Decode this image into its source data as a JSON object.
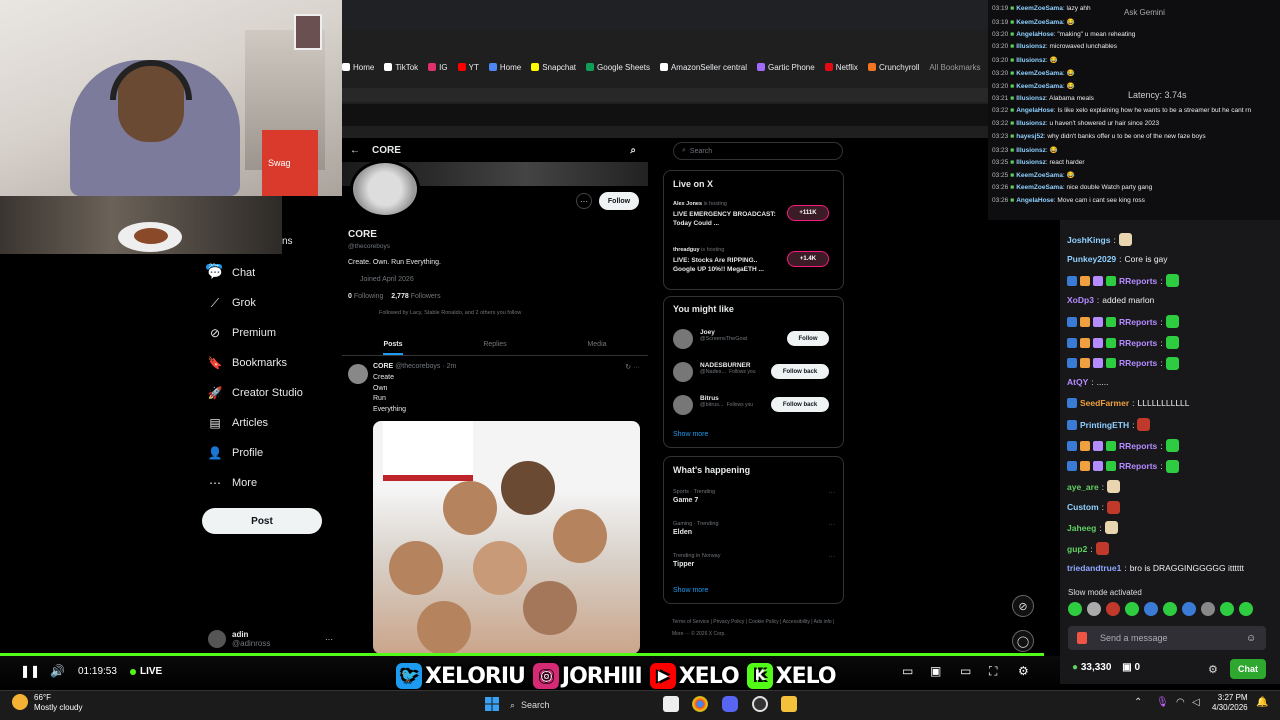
{
  "webcam": {
    "box_label": "Swag"
  },
  "nav": {
    "partial_label": "ns",
    "badge": "20+",
    "items": [
      {
        "label": "Chat",
        "icon": "chat-icon",
        "glyph": "💬"
      },
      {
        "label": "Grok",
        "icon": "grok-icon",
        "glyph": "⟋"
      },
      {
        "label": "Premium",
        "icon": "premium-icon",
        "glyph": "⊘"
      },
      {
        "label": "Bookmarks",
        "icon": "bookmark-icon",
        "glyph": "🔖"
      },
      {
        "label": "Creator Studio",
        "icon": "rocket-icon",
        "glyph": "🚀"
      },
      {
        "label": "Articles",
        "icon": "articles-icon",
        "glyph": "▤"
      },
      {
        "label": "Profile",
        "icon": "profile-icon",
        "glyph": "👤"
      },
      {
        "label": "More",
        "icon": "more-icon",
        "glyph": "⋯"
      }
    ],
    "post_label": "Post",
    "user": {
      "name": "adin",
      "handle": "@adinross"
    }
  },
  "browser": {
    "ask_gemini": "Ask Gemini",
    "bookmarks": [
      {
        "label": "Home",
        "color": "#ffffff"
      },
      {
        "label": "TikTok",
        "color": "#ffffff"
      },
      {
        "label": "IG",
        "color": "#e1306c"
      },
      {
        "label": "YT",
        "color": "#ff0000"
      },
      {
        "label": "Home",
        "color": "#4f86f7"
      },
      {
        "label": "Snapchat",
        "color": "#fffc00"
      },
      {
        "label": "Google Sheets",
        "color": "#0f9d58"
      },
      {
        "label": "AmazonSeller central",
        "color": "#ffffff"
      },
      {
        "label": "Gartic Phone",
        "color": "#a06bff"
      },
      {
        "label": "Netflix",
        "color": "#e50914"
      },
      {
        "label": "Crunchyroll",
        "color": "#f47521"
      }
    ],
    "all_bookmarks": "All Bookmarks"
  },
  "profile": {
    "header_name": "CORE",
    "name": "CORE",
    "handle": "@thecoreboys",
    "bio": "Create. Own. Run Everything.",
    "joined": "Joined April 2026",
    "following_count": "0",
    "following_label": "Following",
    "followers_count": "2,778",
    "followers_label": "Followers",
    "followed_by": "Followed by Lacy, Stable Ronaldo, and 2 others you follow",
    "follow_label": "Follow",
    "tabs": [
      "Posts",
      "Replies",
      "Media"
    ]
  },
  "tweet": {
    "name": "CORE",
    "handle_time": "@thecoreboys · 2m",
    "lines": [
      "Create",
      "Own",
      "Run",
      "Everything"
    ]
  },
  "sidebar": {
    "search_placeholder": "Search",
    "live_title": "Live on X",
    "live": [
      {
        "host": "Alex Jones",
        "hosting": "is hosting",
        "title": "LIVE EMERGENCY BROADCAST: Today Could ...",
        "count": "+111K"
      },
      {
        "host": "threadguy",
        "hosting": "is hosting",
        "title": "LIVE: Stocks Are RIPPING.. Google UP 10%!! MegaETH ...",
        "count": "+1.4K"
      }
    ],
    "might_like_title": "You might like",
    "might_like": [
      {
        "name": "Joey",
        "handle": "@ScreensTheGoat",
        "action": "Follow",
        "follows_you": ""
      },
      {
        "name": "NADESBURNER",
        "handle": "@Nades...",
        "action": "Follow back",
        "follows_you": "Follows you"
      },
      {
        "name": "Bitrus",
        "handle": "@bitrus...",
        "action": "Follow back",
        "follows_you": "Follows you"
      }
    ],
    "show_more": "Show more",
    "happening_title": "What's happening",
    "happening": [
      {
        "context": "Sports · Trending",
        "topic": "Game 7"
      },
      {
        "context": "Gaming · Trending",
        "topic": "Elden"
      },
      {
        "context": "Trending in Norway",
        "topic": "Tipper"
      }
    ],
    "footer": "Terms of Service | Privacy Policy | Cookie Policy | Accessibility | Ads info | More ··· © 2026 X Corp."
  },
  "overlay_chat": {
    "latency": "Latency: 3.74s",
    "lines": [
      {
        "time": "03:19",
        "user": "KeemZoeSama",
        "msg": "lazy ahh"
      },
      {
        "time": "03:19",
        "user": "KeemZoeSama",
        "msg": "😂"
      },
      {
        "time": "03:20",
        "user": "AngelaHose",
        "msg": "\"making\" u mean reheating"
      },
      {
        "time": "03:20",
        "user": "Illusionsz",
        "msg": "microwaved lunchables"
      },
      {
        "time": "03:20",
        "user": "Illusionsz",
        "msg": "😂"
      },
      {
        "time": "03:20",
        "user": "KeemZoeSama",
        "msg": "😂"
      },
      {
        "time": "03:20",
        "user": "KeemZoeSama",
        "msg": "😂"
      },
      {
        "time": "03:21",
        "user": "Illusionsz",
        "msg": "Alabama meals"
      },
      {
        "time": "03:22",
        "user": "AngelaHose",
        "msg": "Is like xelo explaining how he wants to be a streamer but he cant rn"
      },
      {
        "time": "03:22",
        "user": "Illusionsz",
        "msg": "u haven't showered ur hair since 2023"
      },
      {
        "time": "03:23",
        "user": "hayesj52",
        "msg": "why didn't banks offer u to be one of the new faze boys"
      },
      {
        "time": "03:23",
        "user": "Illusionsz",
        "msg": "😂"
      },
      {
        "time": "03:25",
        "user": "Illusionsz",
        "msg": "react harder"
      },
      {
        "time": "03:25",
        "user": "KeemZoeSama",
        "msg": "😂"
      },
      {
        "time": "03:26",
        "user": "KeemZoeSama",
        "msg": "nice double Watch party gang"
      },
      {
        "time": "03:26",
        "user": "AngelaHose",
        "msg": "Move cam i cant see king ross"
      }
    ]
  },
  "twitch_chat": {
    "lines": [
      {
        "user": "JoshKings",
        "color": "#8fd0ff",
        "msg": "",
        "badges": 0,
        "emotes": 1
      },
      {
        "user": "Punkey2029",
        "color": "#8fd0ff",
        "msg": "Core is gay",
        "badges": 0,
        "emotes": 0
      },
      {
        "user": "RReports",
        "color": "#b58cff",
        "msg": "",
        "badges": 4,
        "emotes": 1
      },
      {
        "user": "XoDp3",
        "color": "#b58cff",
        "msg": "added marlon",
        "badges": 0,
        "emotes": 0
      },
      {
        "user": "RReports",
        "color": "#b58cff",
        "msg": "",
        "badges": 4,
        "emotes": 1
      },
      {
        "user": "RReports",
        "color": "#b58cff",
        "msg": "",
        "badges": 4,
        "emotes": 1
      },
      {
        "user": "RReports",
        "color": "#b58cff",
        "msg": "",
        "badges": 4,
        "emotes": 1
      },
      {
        "user": "AtQY",
        "color": "#b58cff",
        "msg": ".....",
        "badges": 0,
        "emotes": 0
      },
      {
        "user": "SeedFarmer",
        "color": "#f0a040",
        "msg": "LLLLLLLLLLL",
        "badges": 1,
        "emotes": 0
      },
      {
        "user": "PrintingETH",
        "color": "#8fd0ff",
        "msg": "",
        "badges": 1,
        "emotes": 1
      },
      {
        "user": "RReports",
        "color": "#b58cff",
        "msg": "",
        "badges": 4,
        "emotes": 1
      },
      {
        "user": "RReports",
        "color": "#b58cff",
        "msg": "",
        "badges": 4,
        "emotes": 1
      },
      {
        "user": "aye_are",
        "color": "#60d060",
        "msg": "",
        "badges": 0,
        "emotes": 1
      },
      {
        "user": "Custom",
        "color": "#8fd0ff",
        "msg": "",
        "badges": 0,
        "emotes": 1
      },
      {
        "user": "Jaheeg",
        "color": "#60d060",
        "msg": "",
        "badges": 0,
        "emotes": 1
      },
      {
        "user": "gup2",
        "color": "#60d060",
        "msg": "",
        "badges": 0,
        "emotes": 1
      },
      {
        "user": "triedandtrue1",
        "color": "#8fa8ff",
        "msg": "bro is DRAGGINGGGGG itttttt",
        "badges": 0,
        "emotes": 0
      }
    ],
    "slow_mode": "Slow mode activated",
    "send_placeholder": "Send a message",
    "points": "33,330",
    "gift_count": "0",
    "chat_button": "Chat"
  },
  "player": {
    "time": "01:19:53",
    "live": "LIVE",
    "progress": 0.985,
    "socials": [
      {
        "handle": "XELORIU",
        "icon": "twitter-icon",
        "glyph": "🐦",
        "color": "#1d9bf0"
      },
      {
        "handle": "JORHIII",
        "icon": "instagram-icon",
        "glyph": "◎",
        "color": "#d62976"
      },
      {
        "handle": "XELO",
        "icon": "youtube-icon",
        "glyph": "▶",
        "color": "#ff0000"
      },
      {
        "handle": "XELO",
        "icon": "kick-icon",
        "glyph": "K",
        "color": "#53fc18"
      }
    ]
  },
  "taskbar": {
    "temp": "66°F",
    "weather": "Mostly cloudy",
    "search": "Search",
    "time": "3:27 PM",
    "date": "4/30/2026"
  }
}
